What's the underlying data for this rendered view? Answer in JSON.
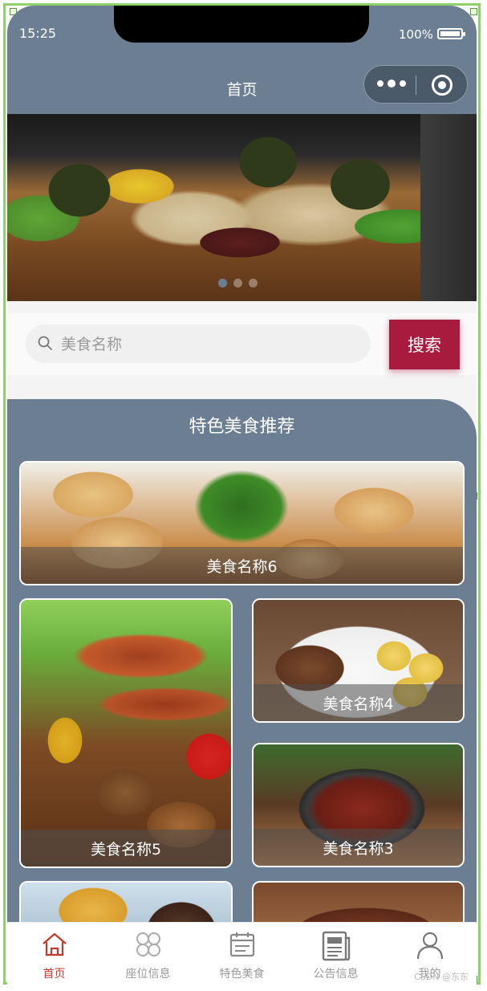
{
  "status_bar": {
    "time": "15:25",
    "battery": "100%"
  },
  "nav": {
    "title": "首页"
  },
  "banner": {
    "dot_count": 3,
    "active_dot": 0
  },
  "search": {
    "placeholder": "美食名称",
    "value": "",
    "button_label": "搜索"
  },
  "recommend": {
    "title": "特色美食推荐",
    "items": [
      {
        "name": "美食名称6"
      },
      {
        "name": "美食名称5"
      },
      {
        "name": "美食名称4"
      },
      {
        "name": "美食名称3"
      }
    ]
  },
  "tabbar": {
    "items": [
      {
        "label": "首页",
        "icon": "home-icon",
        "active": true
      },
      {
        "label": "座位信息",
        "icon": "grid-icon",
        "active": false
      },
      {
        "label": "特色美食",
        "icon": "calendar-icon",
        "active": false
      },
      {
        "label": "公告信息",
        "icon": "newspaper-icon",
        "active": false
      },
      {
        "label": "我的",
        "icon": "user-icon",
        "active": false
      }
    ]
  },
  "watermark": "CSDN @东东",
  "colors": {
    "theme": "#6b7e92",
    "accent": "#a81a3e",
    "active_tab": "#c0392b",
    "selection_frame": "#8ed16b"
  }
}
